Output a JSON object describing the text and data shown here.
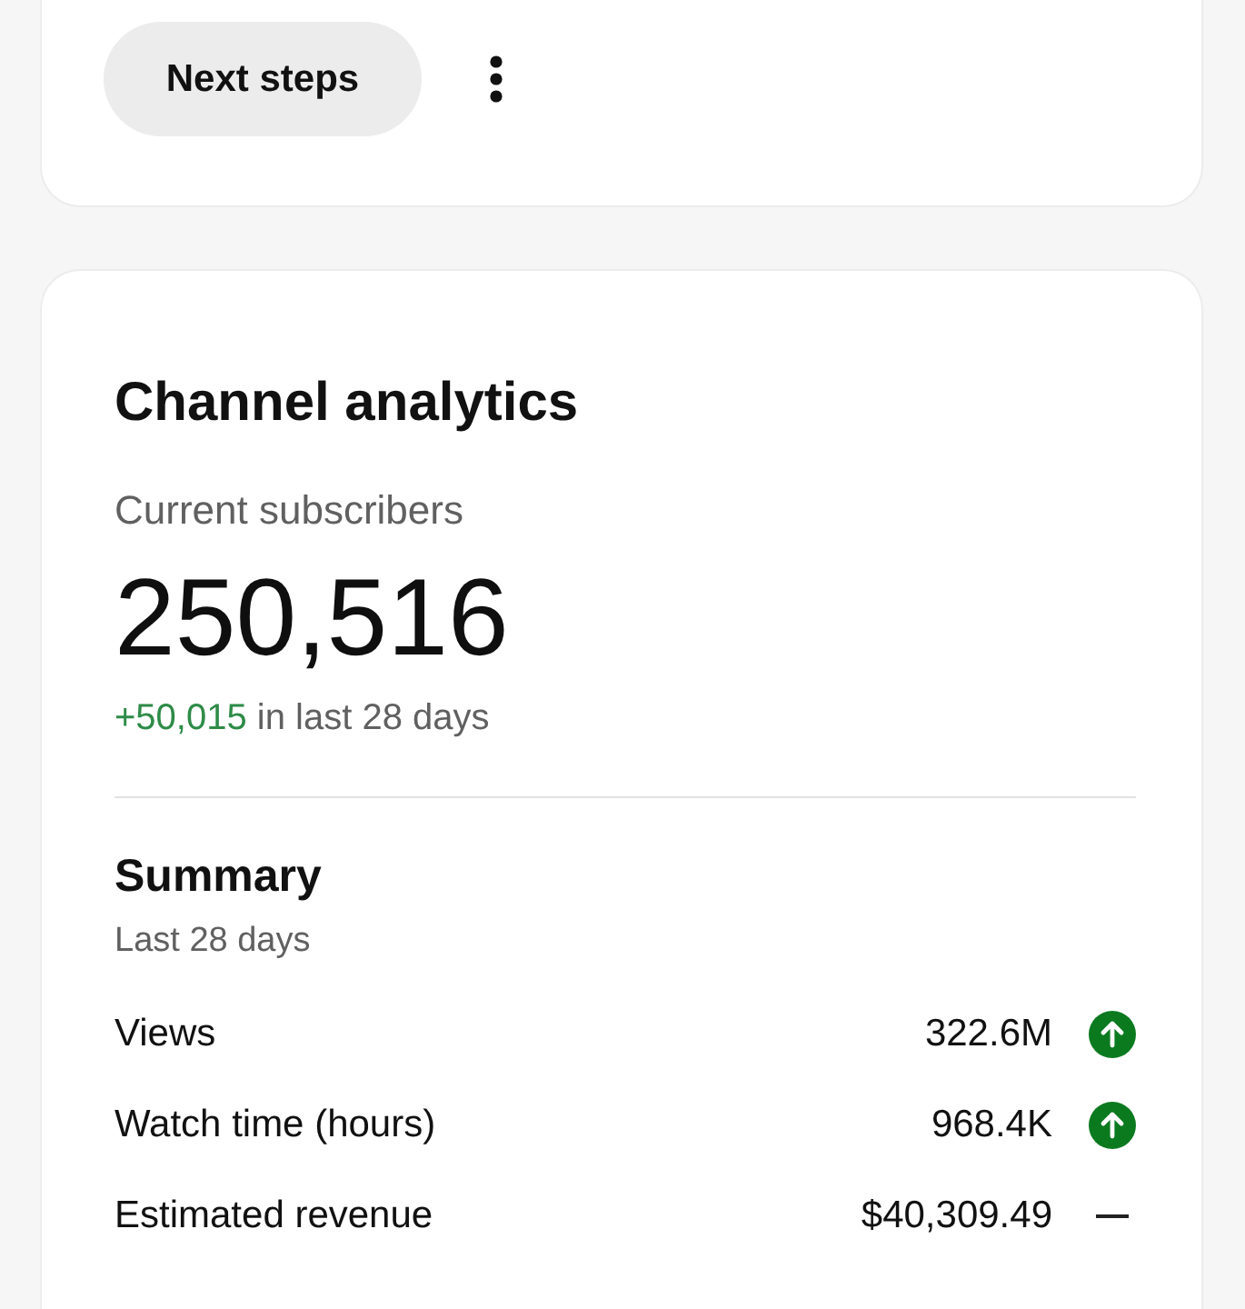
{
  "actions_card": {
    "button": "Next steps"
  },
  "analytics_card": {
    "title": "Channel analytics",
    "subscribers_label": "Current subscribers",
    "subscribers": "250,516",
    "change": {
      "value": "+50,015",
      "text": "in last 28 days"
    },
    "summary": {
      "title": "Summary",
      "period": "Last 28 days",
      "rows": [
        {
          "label": "Views",
          "value": "322.6M",
          "kind": "up"
        },
        {
          "label": "Watch time (hours)",
          "value": "968.4K",
          "kind": "up"
        },
        {
          "label": "Estimated revenue",
          "value": "$40,309.49",
          "kind": "flat"
        }
      ]
    }
  }
}
